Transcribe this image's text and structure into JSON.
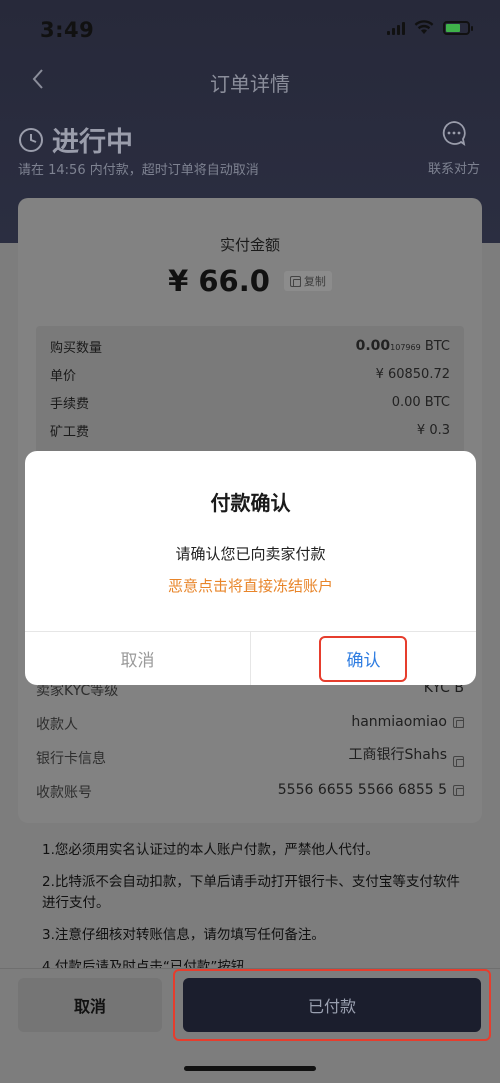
{
  "status_bar": {
    "time": "3:49"
  },
  "nav": {
    "title": "订单详情"
  },
  "order_status": {
    "title": "进行中",
    "subtitle": "请在 14:56 内付款，超时订单将自动取消",
    "contact_label": "联系对方"
  },
  "amount": {
    "label": "实付金额",
    "value": "¥ 66.0",
    "copy_label": "复制"
  },
  "details": [
    {
      "label": "购买数量",
      "value_main": "0.00",
      "value_small": "107969",
      "value_unit": " BTC"
    },
    {
      "label": "单价",
      "value": "¥ 60850.72"
    },
    {
      "label": "手续费",
      "value": "0.00 BTC"
    },
    {
      "label": "矿工费",
      "value": "¥ 0.3"
    }
  ],
  "seller": [
    {
      "label": "卖家KYC等级",
      "value": "KYC B"
    },
    {
      "label": "收款人",
      "value": "hanmiaomiao"
    },
    {
      "label": "银行卡信息",
      "value": "工商银行Shahs"
    },
    {
      "label": "收款账号",
      "value": "5556 6655 5566 6855 5"
    }
  ],
  "notes": [
    "1.您必须用实名认证过的本人账户付款，严禁他人代付。",
    "2.比特派不会自动扣款，下单后请手动打开银行卡、支付宝等支付软件进行支付。",
    "3.注意仔细核对转账信息，请勿填写任何备注。",
    "4.付款后请及时点击“已付款”按钮"
  ],
  "bottom": {
    "cancel_label": "取消",
    "paid_label": "已付款"
  },
  "modal": {
    "title": "付款确认",
    "message": "请确认您已向卖家付款",
    "warning": "恶意点击将直接冻结账户",
    "cancel_label": "取消",
    "confirm_label": "确认"
  },
  "colors": {
    "warning": "#e8852a",
    "confirm": "#2f7de1",
    "highlight": "#e63d2d",
    "primary_dark": "#1b1e2d"
  },
  "icons": [
    "back-chevron-icon",
    "clock-icon",
    "chat-bubble-icon",
    "copy-icon",
    "signal-icon",
    "wifi-icon",
    "battery-icon"
  ]
}
